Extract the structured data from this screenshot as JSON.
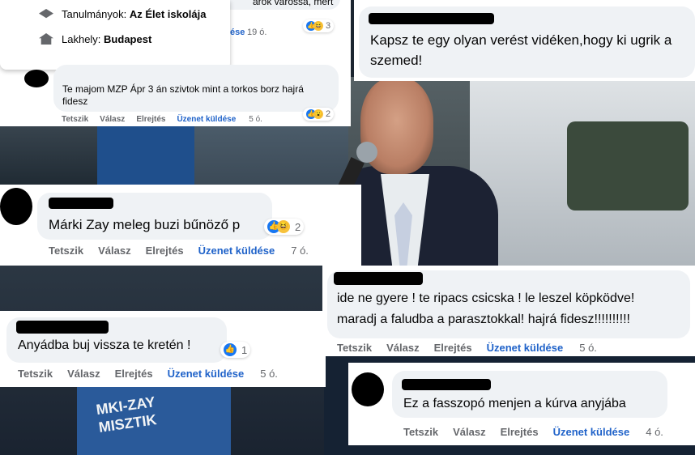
{
  "profile_popup": {
    "studies_label": "Tanulmányok:",
    "studies_value": "Az Élet iskolája",
    "home_label": "Lakhely:",
    "home_value": "Budapest"
  },
  "top_left_peek": {
    "partial_text": "arok  várossa, mert",
    "time": "19 ó.",
    "reactions": "3",
    "action_partial": "ése"
  },
  "comment_torkos": {
    "text_line1": "Te majom MZP Ápr 3 án szivtok mint a torkos borz hajrá",
    "text_line2": "fidesz",
    "reactions": "2",
    "time": "5 ó."
  },
  "comment_top_right": {
    "text_line1": "Kapsz te egy olyan verést vidéken,hogy ki ugrik a",
    "text_line2": "szemed!"
  },
  "comment_marki": {
    "text": "Márki Zay meleg buzi bűnöző p",
    "reactions": "2",
    "time": "7 ó."
  },
  "comment_ide": {
    "text_line1": "ide ne gyere ! te ripacs csicska ! le leszel köpködve!",
    "text_line2": "maradj a faludba a parasztokkal! hajrá fidesz!!!!!!!!!!",
    "time": "5 ó."
  },
  "comment_anyadba": {
    "text": "Anyádba buj vissza te kretén !",
    "reactions": "1",
    "time": "5 ó."
  },
  "comment_fasszopo": {
    "text": "Ez a fasszopó menjen a kúrva anyjába",
    "time": "4 ó."
  },
  "actions": {
    "like": "Tetszik",
    "reply": "Válasz",
    "hide": "Elrejtés",
    "message": "Üzenet küldése"
  },
  "sign_text_line1": "MKI-ZAY",
  "sign_text_line2": "MISZTIK",
  "colors": {
    "link_blue": "#1f62c9",
    "bubble_gray": "#eff2f5",
    "like_blue": "#1877f2",
    "muted_gray": "#65676b"
  }
}
